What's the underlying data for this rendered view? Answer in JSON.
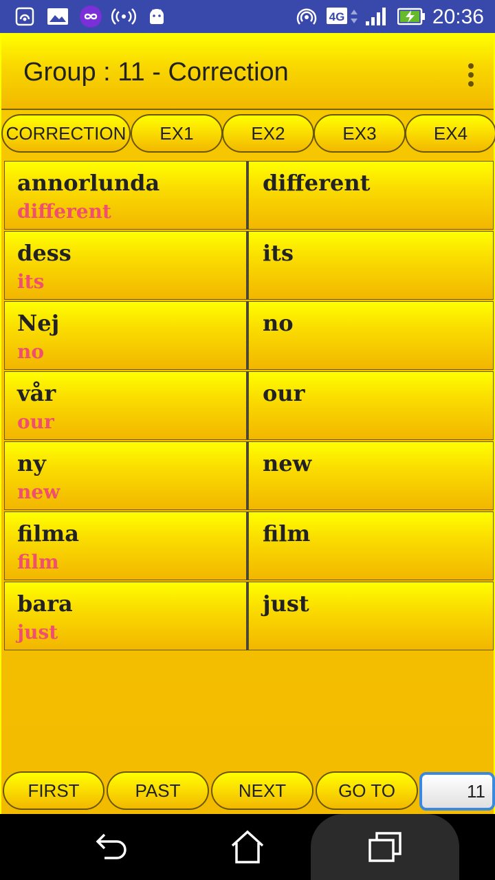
{
  "status_bar": {
    "time": "20:36",
    "network": "4G",
    "icons": [
      "hotspot-icon",
      "gallery-icon",
      "infinity-app-icon",
      "broadcast-icon",
      "android-icon",
      "wifi-hotspot-icon",
      "mobile-data-icon",
      "signal-icon",
      "battery-charging-icon"
    ]
  },
  "app_bar": {
    "title": "Group : 11 - Correction",
    "menu_icon": "overflow-menu-icon"
  },
  "tabs": [
    {
      "label": "CORRECTION"
    },
    {
      "label": "EX1"
    },
    {
      "label": "EX2"
    },
    {
      "label": "EX3"
    },
    {
      "label": "EX4"
    }
  ],
  "rows": [
    {
      "word": "annorlunda",
      "translation": "different",
      "answer": "different"
    },
    {
      "word": "dess",
      "translation": "its",
      "answer": "its"
    },
    {
      "word": "Nej",
      "translation": "no",
      "answer": "no"
    },
    {
      "word": "vår",
      "translation": "our",
      "answer": "our"
    },
    {
      "word": "ny",
      "translation": "new",
      "answer": "new"
    },
    {
      "word": "filma",
      "translation": "film",
      "answer": "film"
    },
    {
      "word": "bara",
      "translation": "just",
      "answer": "just"
    }
  ],
  "bottom": {
    "first": "FIRST",
    "past": "PAST",
    "next": "NEXT",
    "goto": "GO TO",
    "goto_value": "11"
  },
  "nav_bar": {
    "icons": [
      "back-icon",
      "home-icon",
      "recents-icon"
    ]
  },
  "colors": {
    "status_bar": "#3949ab",
    "cell_yellow": "#f9d700",
    "translation_text": "#f0506e",
    "input_border": "#3a88e0"
  }
}
